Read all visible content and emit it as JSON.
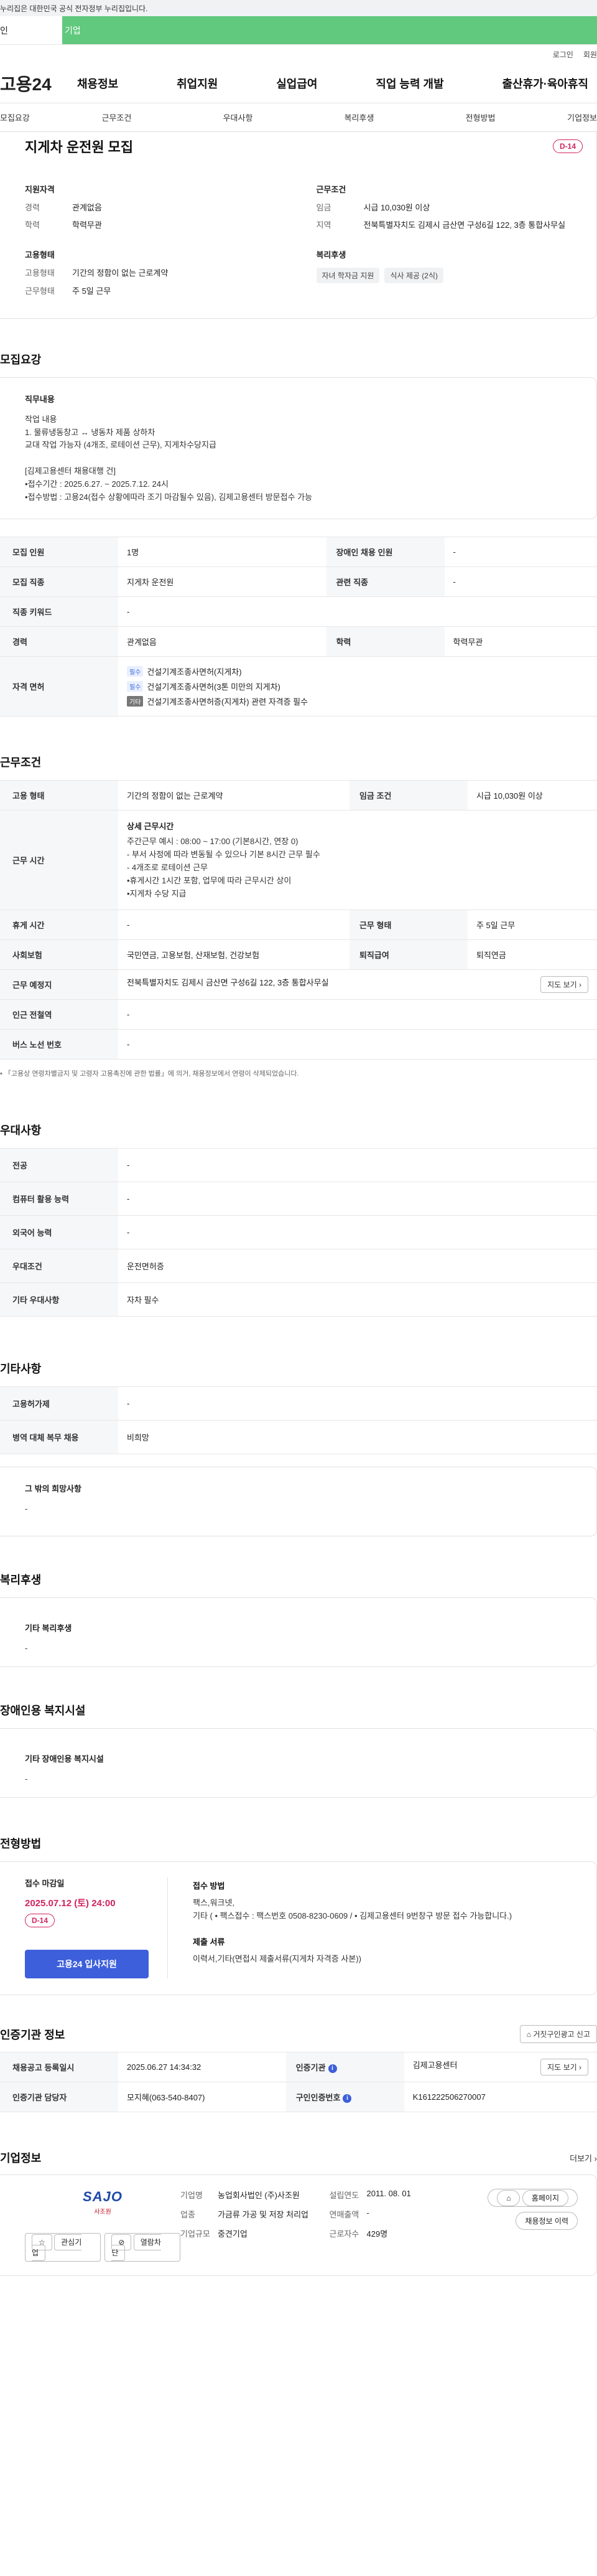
{
  "gov_banner": "누리집은 대한민국 공식 전자정부 누리집입니다.",
  "tabs": {
    "personal": "인",
    "company": "기업"
  },
  "util": {
    "login": "로그인",
    "signup": "회원"
  },
  "gnb": {
    "logo": "고용24",
    "menu": [
      "채용정보",
      "취업지원",
      "실업급여",
      "직업 능력 개발",
      "출산휴가·육아휴직"
    ]
  },
  "subnav": [
    "모집요강",
    "근무조건",
    "우대사항",
    "복리후생",
    "전형방법",
    "기업정보"
  ],
  "hero": {
    "title": "지게차 운전원 모집",
    "dday": "D-14",
    "qual_title": "지원자격",
    "qual": [
      {
        "k": "경력",
        "v": "관계없음"
      },
      {
        "k": "학력",
        "v": "학력무관"
      }
    ],
    "cond_title": "근무조건",
    "cond": [
      {
        "k": "임금",
        "v": "시급 10,030원 이상"
      },
      {
        "k": "지역",
        "v": "전북특별자치도 김제시 금산면 구성6길 122, 3층 통합사무실"
      }
    ],
    "type_title": "고용형태",
    "type": [
      {
        "k": "고용형태",
        "v": "기간의 정함이 없는 근로계약"
      },
      {
        "k": "근무형태",
        "v": "주 5일 근무"
      }
    ],
    "welfare_title": "복리후생",
    "welfare_chips": [
      "자녀 학자금 지원",
      "식사 제공 (2식)"
    ]
  },
  "recruit": {
    "section_title": "모집요강",
    "duty_title": "직무내용",
    "duty_text": "작업 내용\n1. 물류냉동창고 ↔ 냉동차 제품 상하차\n교대 작업 가능자 (4개조, 로테이션 근무), 지게차수당지급\n\n[김제고용센터 채용대행 건]\n•접수기간 : 2025.6.27. ~ 2025.7.12. 24시\n•접수방법 : 고용24(접수 상황에따라 조기 마감될수 있음), 김제고용센터 방문접수 가능",
    "rows": {
      "count_label": "모집 인원",
      "count": "1명",
      "disabled_label": "장애인 채용 인원",
      "disabled": "-",
      "job_label": "모집 직종",
      "job": "지게차 운전원",
      "related_label": "관련 직종",
      "related": "-",
      "keyword_label": "직종 키워드",
      "keyword": "-",
      "career_label": "경력",
      "career": "관계없음",
      "edu_label": "학력",
      "edu": "학력무관",
      "license_label": "자격 면허",
      "licenses": [
        {
          "tag": "필수",
          "text": "건설기계조종사면허(지게차)"
        },
        {
          "tag": "필수",
          "text": "건설기계조종사면허(3톤 미만의 지게차)"
        },
        {
          "tag": "기타",
          "text": "건설기계조종사면허증(지게차) 관련 자격증 필수"
        }
      ]
    }
  },
  "work": {
    "section_title": "근무조건",
    "emp_type_label": "고용 형태",
    "emp_type": "기간의 정함이 없는 근로계약",
    "wage_label": "임금 조건",
    "wage": "시급 10,030원 이상",
    "hours_label": "근무 시간",
    "hours_title": "상세 근무시간",
    "hours_text": "주간근무 예시 : 08:00 ~ 17:00 (기본8시간, 연장 0)\n- 부서 사정에 따라 변동될 수 있으나 기본 8시간 근무 필수\n- 4개조로 로테이션 근무\n•휴게시간 1시간 포함, 업무에 따라 근무시간 상이\n•지게차 수당 지급",
    "break_label": "휴게 시간",
    "break": "-",
    "form_label": "근무 형태",
    "form": "주 5일 근무",
    "insurance_label": "사회보험",
    "insurance": "국민연금, 고용보험, 산재보험, 건강보험",
    "retire_label": "퇴직급여",
    "retire": "퇴직연금",
    "place_label": "근무 예정지",
    "place": "전북특별자치도 김제시 금산면 구성6길 122, 3층 통합사무실",
    "map_btn": "지도 보기",
    "subway_label": "인근 전철역",
    "subway": "-",
    "bus_label": "버스 노선 번호",
    "bus": "-",
    "note": "「고용상 연령차별금지 및 고령자 고용촉진에 관한 법률」에 의거, 채용정보에서 연령이 삭제되었습니다."
  },
  "prefer": {
    "section_title": "우대사항",
    "rows": [
      {
        "k": "전공",
        "v": "-"
      },
      {
        "k": "컴퓨터 활용 능력",
        "v": "-"
      },
      {
        "k": "외국어 능력",
        "v": "-"
      },
      {
        "k": "우대조건",
        "v": "운전면허증"
      },
      {
        "k": "기타 우대사항",
        "v": "자차 필수"
      }
    ]
  },
  "etc": {
    "section_title": "기타사항",
    "rows": [
      {
        "k": "고용허가제",
        "v": "-"
      },
      {
        "k": "병역 대체 복무 채용",
        "v": "비희망"
      }
    ],
    "box_title": "그 밖의 희망사항",
    "box_text": "-"
  },
  "welfare": {
    "section_title": "복리후생",
    "box_title": "기타 복리후생",
    "box_text": "-"
  },
  "disabled": {
    "section_title": "장애인용 복지시설",
    "box_title": "기타 장애인용 복지시설",
    "box_text": "-"
  },
  "selection": {
    "section_title": "전형방법",
    "deadline_label": "접수 마감일",
    "deadline": "2025.07.12 (토) 24:00",
    "dday": "D-14",
    "apply_btn": "고용24 입사지원",
    "method_label": "접수 방법",
    "method_text": "팩스,워크넷,\n기타 ( • 팩스접수 : 팩스번호 0508-8230-0609 / • 김제고용센터 9번창구 방문 접수 가능합니다.)",
    "docs_label": "제출 서류",
    "docs_text": "이력서,기타(면접시 제출서류(지게차 자격증 사본))"
  },
  "cert": {
    "section_title": "인증기관 정보",
    "report_btn": "거짓구인광고 신고",
    "reg_label": "채용공고 등록일시",
    "reg": "2025.06.27 14:34:32",
    "org_label": "인증기관",
    "org": "김제고용센터",
    "map_btn": "지도 보기",
    "manager_label": "인증기관 담당자",
    "manager": "모지혜(063-540-8407)",
    "id_label": "구인인증번호",
    "id": "K161222506270007"
  },
  "company": {
    "section_title": "기업정보",
    "more": "더보기",
    "logo_text": "SAJO",
    "logo_sub": "사조원",
    "fav_btn": "관심기업",
    "block_btn": "열람차단",
    "name_label": "기업명",
    "name": "농업회사법인 (주)사조원",
    "industry_label": "업종",
    "industry": "가금류 가공 및 저장 처리업",
    "size_label": "기업규모",
    "size": "중견기업",
    "founded_label": "설립연도",
    "founded": "2011. 08. 01",
    "sales_label": "연매출액",
    "sales": "-",
    "staff_label": "근로자수",
    "staff": "429명",
    "homepage_btn": "홈페이지",
    "jobs_btn": "채용정보 이력"
  }
}
